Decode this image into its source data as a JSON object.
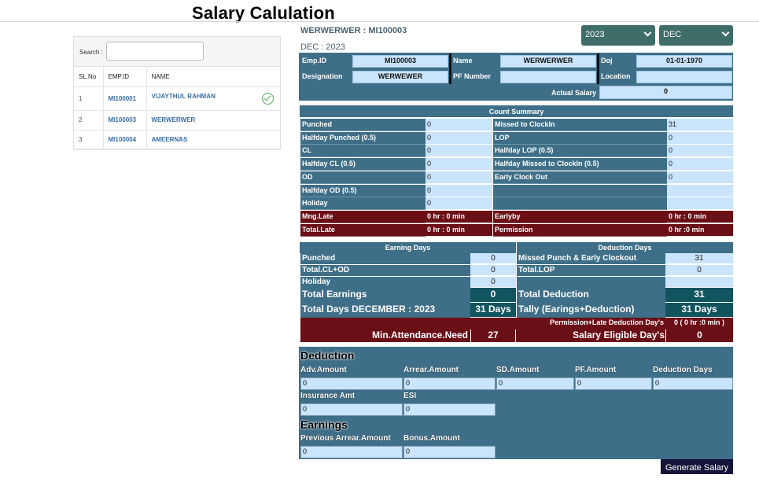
{
  "page_title": "Salary Calulation",
  "search": {
    "label": "Search :",
    "value": "",
    "placeholder": ""
  },
  "employee_table": {
    "headers": [
      "SL.No",
      "EMP.ID",
      "NAME"
    ],
    "rows": [
      {
        "sl": "1",
        "emp_id": "MI100001",
        "name": "VIJAYTHUL RAHMAN",
        "checked": true
      },
      {
        "sl": "2",
        "emp_id": "MI100003",
        "name": "WERWERWER",
        "checked": false
      },
      {
        "sl": "3",
        "emp_id": "MI100004",
        "name": "AMEERNAS",
        "checked": false
      }
    ]
  },
  "header": {
    "employee": "WERWERWER : MI100003",
    "period": "DEC : 2023"
  },
  "filters": {
    "year": "2023",
    "month": "DEC"
  },
  "employee_info": {
    "emp_id_label": "Emp.ID",
    "emp_id": "MI100003",
    "name_label": "Name",
    "name": "WERWERWER",
    "doj_label": "Doj",
    "doj": "01-01-1970",
    "designation_label": "Designation",
    "designation": "WERWEWER",
    "pf_label": "PF Number",
    "pf": "",
    "location_label": "Location",
    "location": "",
    "actual_salary_label": "Actual Salary",
    "actual_salary": "0"
  },
  "count_summary": {
    "title": "Count Summary",
    "rows": [
      {
        "l1": "Punched",
        "v1": "0",
        "l2": "Missed to ClockIn",
        "v2": "31",
        "dark": false
      },
      {
        "l1": "Halfday Punched (0.5)",
        "v1": "0",
        "l2": "LOP",
        "v2": "0",
        "dark": false
      },
      {
        "l1": "CL",
        "v1": "0",
        "l2": "Halfday LOP (0.5)",
        "v2": "0",
        "dark": false
      },
      {
        "l1": "Halfday CL (0.5)",
        "v1": "0",
        "l2": "Halfday Missed to ClockIn (0.5)",
        "v2": "0",
        "dark": false
      },
      {
        "l1": "OD",
        "v1": "0",
        "l2": "Early Clock Out",
        "v2": "0",
        "dark": false
      },
      {
        "l1": "Halfday OD (0.5)",
        "v1": "0",
        "l2": "",
        "v2": "",
        "dark": false
      },
      {
        "l1": "Holiday",
        "v1": "0",
        "l2": "",
        "v2": "",
        "dark": false
      },
      {
        "l1": "Mng.Late",
        "v1": "0 hr : 0 min",
        "l2": "Earlyby",
        "v2": "0 hr : 0 min",
        "dark": true
      },
      {
        "l1": "Total.Late",
        "v1": "0 hr : 0 min",
        "l2": "Permission",
        "v2": "0 hr :0 min",
        "dark": true
      }
    ]
  },
  "days": {
    "earning_title": "Earning Days",
    "deduction_title": "Deduction Days",
    "rows": [
      {
        "l1": "Punched",
        "v1": "0",
        "l2": "Missed Punch & Early Clockout",
        "v2": "31"
      },
      {
        "l1": "Total.CL+OD",
        "v1": "0",
        "l2": "Total.LOP",
        "v2": "0"
      },
      {
        "l1": "Holiday",
        "v1": "0",
        "l2": "",
        "v2": ""
      }
    ],
    "total_earnings_label": "Total Earnings",
    "total_earnings": "0",
    "total_deduction_label": "Total Deduction",
    "total_deduction": "31",
    "total_days_label": "Total Days DECEMBER : 2023",
    "total_days": "31 Days",
    "tally_label": "Tally (Earings+Deduction)",
    "tally": "31 Days",
    "perm_late_label": "Permission+Late Deduction Day's",
    "perm_late": "0 ( 0 hr :0 min )",
    "min_att_label": "Min.Attendance.Need",
    "min_att": "27",
    "eligible_label": "Salary Eligible Day's",
    "eligible": "0"
  },
  "deduction": {
    "title": "Deduction",
    "fields": [
      {
        "label": "Adv.Amount",
        "value": "0"
      },
      {
        "label": "Arrear.Amount",
        "value": "0"
      },
      {
        "label": "SD.Amount",
        "value": "0"
      },
      {
        "label": "PF.Amount",
        "value": "0"
      },
      {
        "label": "Deduction Days",
        "value": "0"
      },
      {
        "label": "Insurance Amt",
        "value": "0"
      },
      {
        "label": "ESI",
        "value": "0"
      }
    ]
  },
  "earnings": {
    "title": "Earnings",
    "fields": [
      {
        "label": "Previous Arrear.Amount",
        "value": "0"
      },
      {
        "label": "Bonus.Amount",
        "value": "0"
      }
    ]
  },
  "generate_label": "Generate Salary"
}
